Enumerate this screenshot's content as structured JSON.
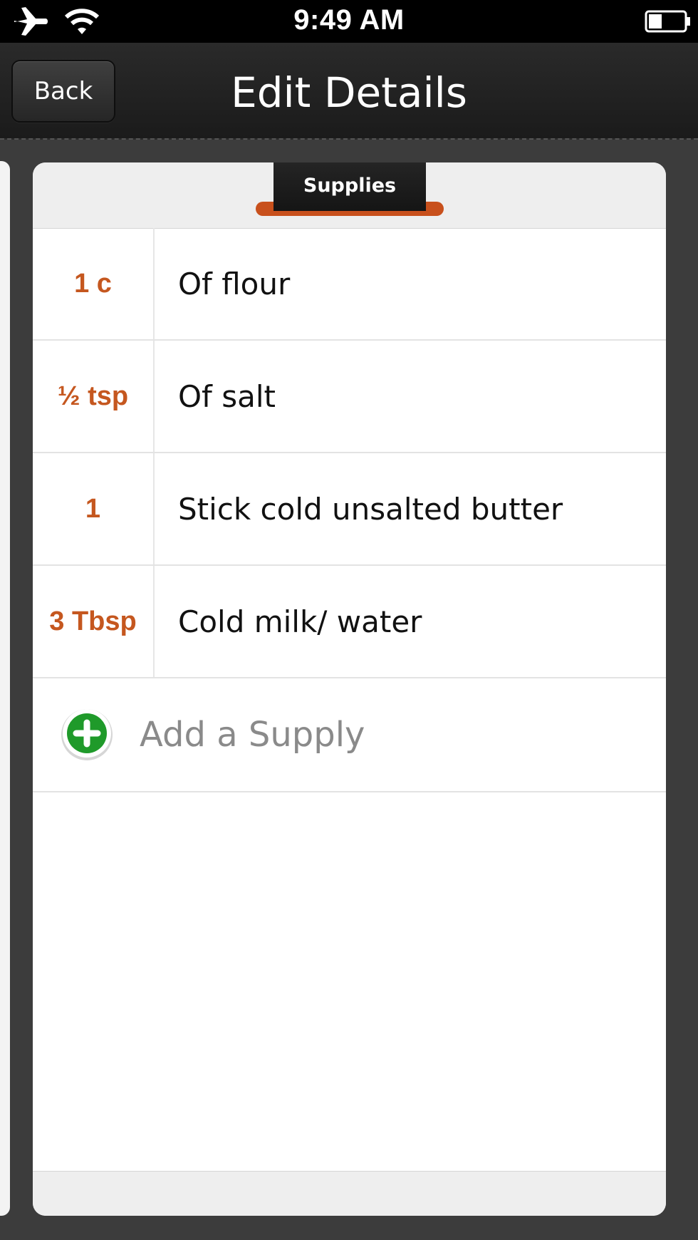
{
  "status_bar": {
    "time": "9:49 AM",
    "airplane_icon": "airplane-icon",
    "wifi_icon": "wifi-icon",
    "battery_icon": "battery-icon"
  },
  "nav": {
    "back_label": "Back",
    "title": "Edit Details"
  },
  "card": {
    "tab_label": "Supplies",
    "accent_color": "#c5571f",
    "supplies": [
      {
        "qty": "1 c",
        "name": "Of flour"
      },
      {
        "qty": "½ tsp",
        "name": "Of salt"
      },
      {
        "qty": "1",
        "name": "Stick cold unsalted butter"
      },
      {
        "qty": "3 Tbsp",
        "name": "Cold milk/ water"
      }
    ],
    "add_label": "Add a Supply",
    "add_icon": "plus-circle-icon"
  }
}
